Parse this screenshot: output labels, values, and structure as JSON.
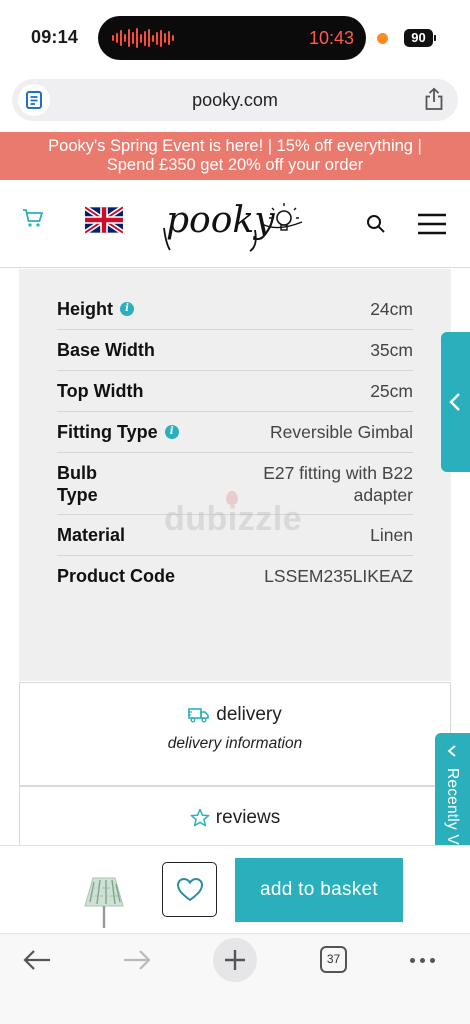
{
  "status_bar": {
    "time": "09:14",
    "recording_time": "10:43",
    "battery": "90"
  },
  "browser": {
    "url": "pooky.com",
    "tabs_count": "37"
  },
  "promo": {
    "line1": "Pooky's Spring Event is here! | 15% off everything |",
    "line2": "Spend £350 get 20% off your order"
  },
  "header": {
    "logo": "pooky"
  },
  "specs": [
    {
      "label": "Height",
      "value": "24cm",
      "info": true
    },
    {
      "label": "Base Width",
      "value": "35cm",
      "info": false
    },
    {
      "label": "Top Width",
      "value": "25cm",
      "info": false
    },
    {
      "label": "Fitting Type",
      "value": "Reversible Gimbal",
      "info": true
    },
    {
      "label_line1": "Bulb",
      "label_line2": "Type",
      "value_line1": "E27 fitting with B22",
      "value_line2": "adapter",
      "info": false
    },
    {
      "label": "Material",
      "value": "Linen",
      "info": false
    },
    {
      "label": "Product Code",
      "value": "LSSEM235LIKEAZ",
      "info": false
    }
  ],
  "watermark": "dubizzle",
  "delivery": {
    "title": "delivery",
    "subtitle": "delivery information"
  },
  "reviews": {
    "title": "reviews"
  },
  "recently_viewed": "Recently Viewed",
  "actions": {
    "add_to_basket": "add to basket"
  },
  "colors": {
    "brand_teal": "#2ab0bd",
    "promo_coral": "#ea7a6d",
    "panel_gray": "#efefef"
  }
}
